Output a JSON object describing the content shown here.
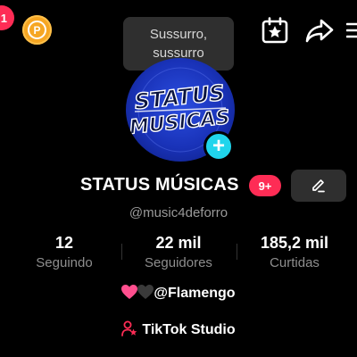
{
  "top_bar": {
    "notification_count": "1",
    "coin_label": "P",
    "icons": [
      "coin-icon",
      "calendar-star-icon",
      "share-icon",
      "menu-icon"
    ]
  },
  "tooltip": {
    "line1": "Sussurro,",
    "line2": "sussurro"
  },
  "profile": {
    "avatar_text_top": "STATUS",
    "avatar_text_bottom": "MUSICAS",
    "avatar_add_label": "+",
    "display_name": "STATUS MÚSICAS",
    "name_badge": "9+",
    "username": "@music4deforro"
  },
  "stats": [
    {
      "value": "12",
      "label": "Seguindo"
    },
    {
      "value": "22 mil",
      "label": "Seguidores"
    },
    {
      "value": "185,2 mil",
      "label": "Curtidas"
    }
  ],
  "bio": {
    "hearts_text": "@Flamengo",
    "studio_text": "TikTok Studio"
  },
  "colors": {
    "background": "#000000",
    "badge_red": "#fe2c55",
    "coin_orange": "#f6a623",
    "add_cyan": "#20d5ec",
    "tooltip_bg": "#2f2f2f",
    "muted_text": "#8e8e8e"
  }
}
